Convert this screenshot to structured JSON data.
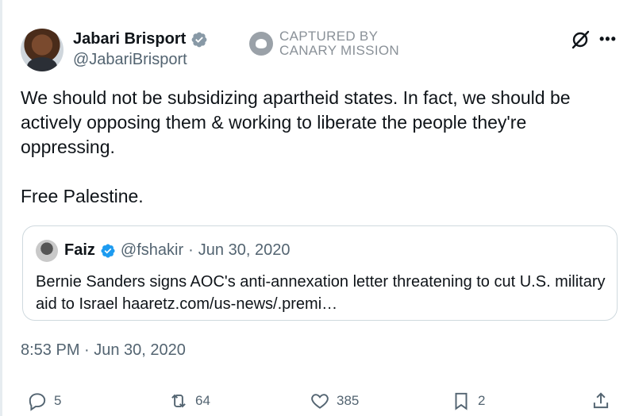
{
  "author": {
    "display_name": "Jabari Brisport",
    "handle": "@JabariBrisport",
    "verified": true
  },
  "watermark": {
    "line1": "CAPTURED BY",
    "line2": "CANARY MISSION"
  },
  "header_icons": [
    "grok-icon",
    "more-icon"
  ],
  "tweet": {
    "paragraph1": "We should not be subsidizing apartheid states. In fact, we should be actively opposing them & working to liberate the people they're oppressing.",
    "paragraph2": "Free Palestine."
  },
  "quote": {
    "display_name": "Faiz",
    "handle": "@fshakir",
    "separator": "·",
    "date": "Jun 30, 2020",
    "text": "Bernie Sanders signs AOC's anti-annexation letter threatening to cut U.S. military aid to Israel haaretz.com/us-news/.premi…"
  },
  "timestamp": "8:53 PM · Jun 30, 2020",
  "actions": {
    "replies": "5",
    "reposts": "64",
    "likes": "385",
    "bookmarks": "2"
  },
  "colors": {
    "verified_badge": "#1d9bf0",
    "text_primary": "#0f1419",
    "text_secondary": "#536471",
    "border": "#cfd9de"
  }
}
